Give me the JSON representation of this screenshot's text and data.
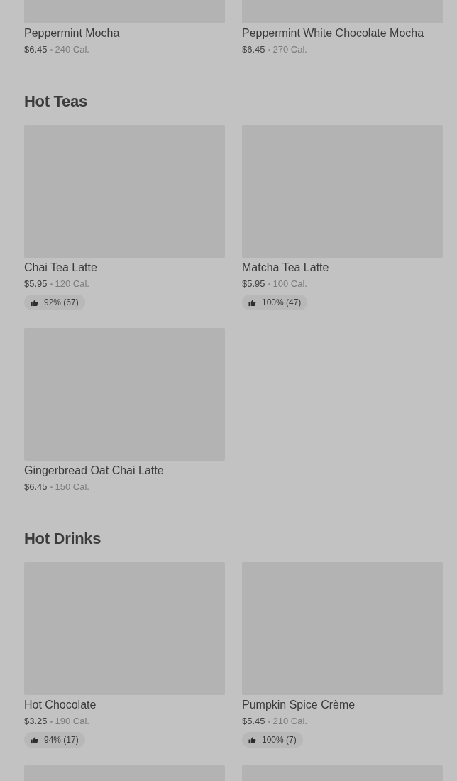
{
  "sections": [
    {
      "items": [
        {
          "kind": "item",
          "name": "Peppermint Mocha",
          "price": "$6.45",
          "calories": "240 Cal."
        },
        {
          "kind": "item",
          "name": "Peppermint White Chocolate Mocha",
          "price": "$6.45",
          "calories": "270 Cal."
        }
      ]
    },
    {
      "title": "Hot Teas",
      "items": [
        {
          "kind": "item",
          "name": "Chai Tea Latte",
          "price": "$5.95",
          "calories": "120 Cal.",
          "rating": "92% (67)"
        },
        {
          "kind": "item",
          "name": "Matcha Tea Latte",
          "price": "$5.95",
          "calories": "100 Cal.",
          "rating": "100% (47)"
        },
        {
          "kind": "item",
          "name": "Gingerbread Oat Chai Latte",
          "price": "$6.45",
          "calories": "150 Cal."
        }
      ]
    },
    {
      "title": "Hot Drinks",
      "items": [
        {
          "kind": "item",
          "name": "Hot Chocolate",
          "price": "$3.25",
          "calories": "190 Cal.",
          "rating": "94% (17)"
        },
        {
          "kind": "item",
          "name": "Pumpkin Spice Crème",
          "price": "$5.45",
          "calories": "210 Cal.",
          "rating": "100% (7)"
        },
        {
          "kind": "picture"
        },
        {
          "kind": "picture"
        }
      ]
    }
  ]
}
